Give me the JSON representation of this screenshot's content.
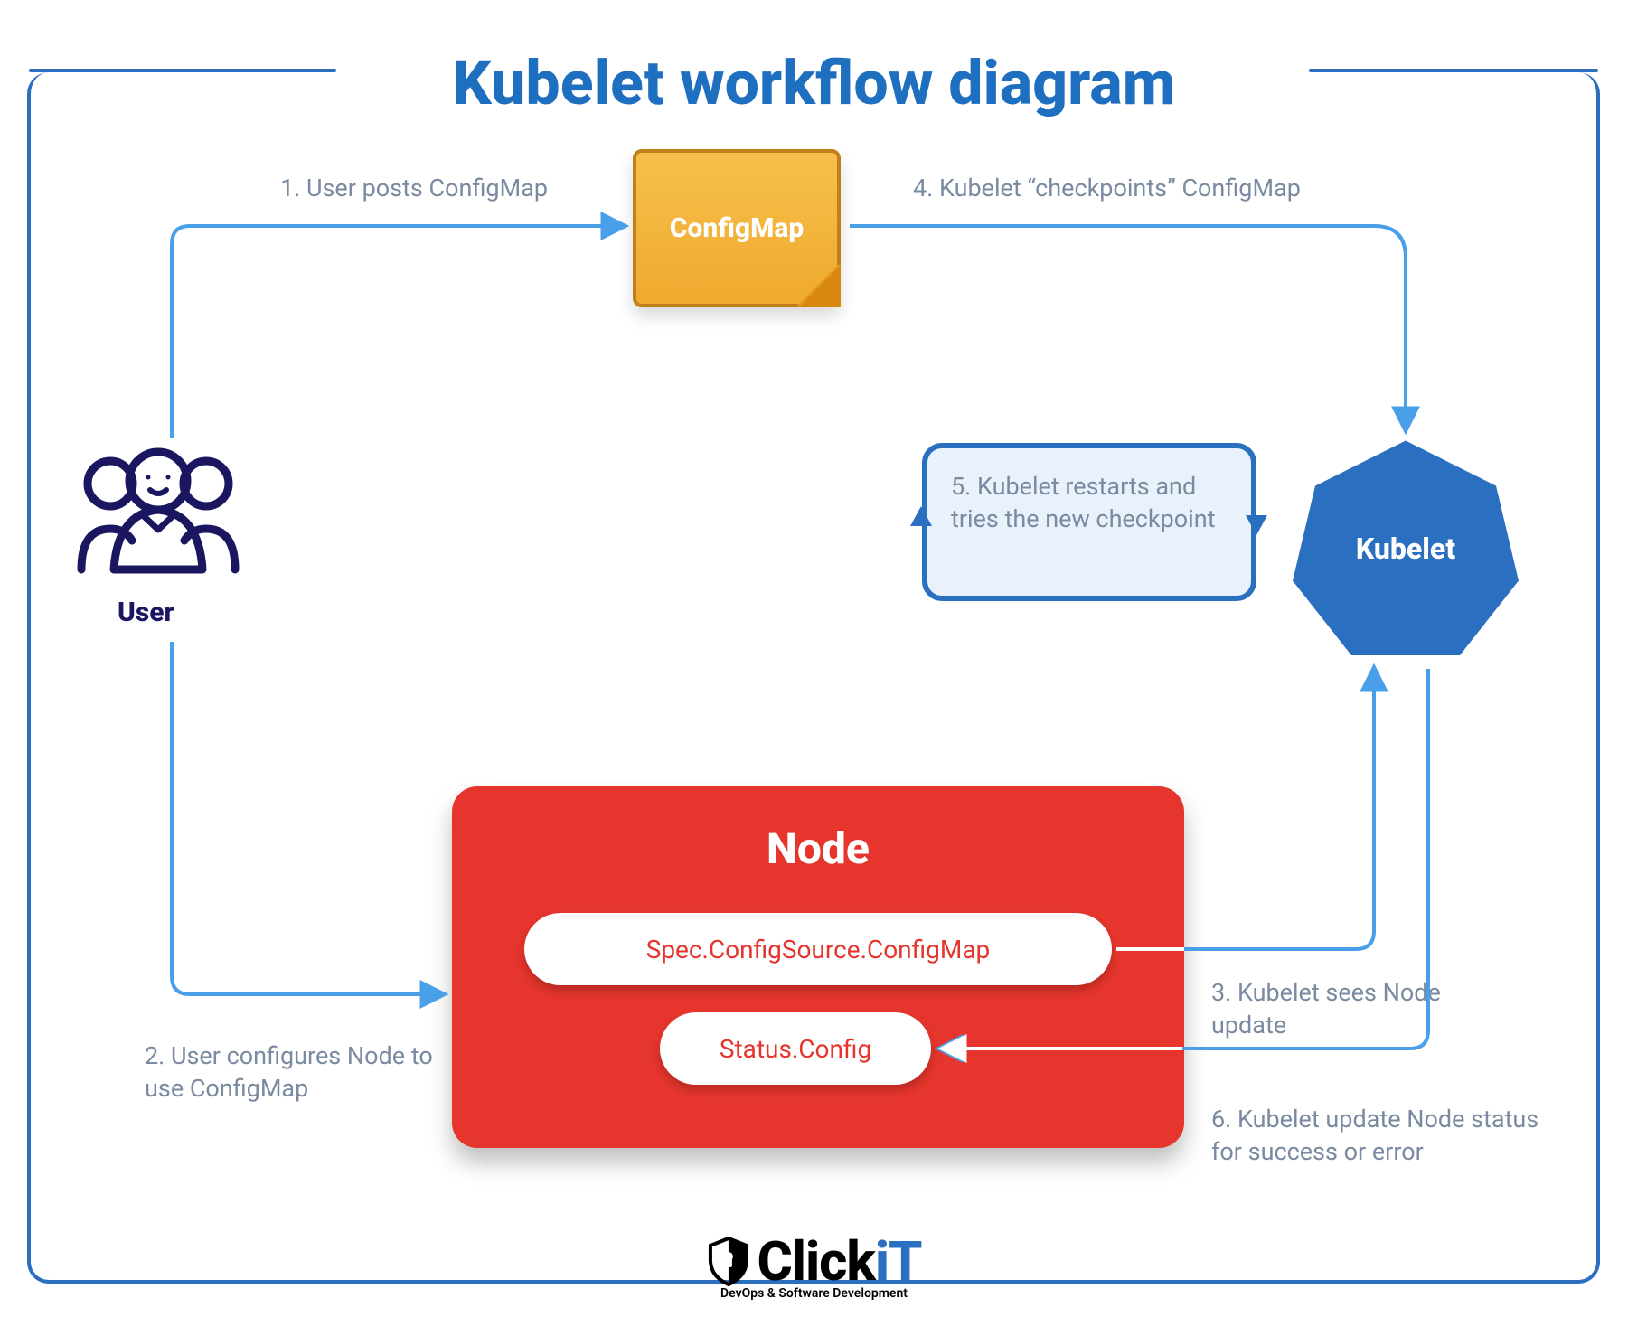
{
  "title": "Kubelet workflow diagram",
  "entities": {
    "user": "User",
    "configmap": "ConfigMap",
    "kubelet": "Kubelet",
    "node": "Node",
    "node_fields": {
      "spec": "Spec.ConfigSource.ConfigMap",
      "status": "Status.Config"
    }
  },
  "steps": {
    "s1": "1. User posts ConfigMap",
    "s2": "2. User configures Node to use ConfigMap",
    "s3": "3. Kubelet sees Node update",
    "s4": "4. Kubelet “checkpoints” ConfigMap",
    "s5": "5. Kubelet restarts and tries the new checkpoint",
    "s6": "6. Kubelet update Node status for success or error"
  },
  "logo": {
    "brand_prefix": "Click",
    "brand_suffix": "iT",
    "tagline": "DevOps & Software Development"
  },
  "colors": {
    "blue": "#2b6fc0",
    "lightblue": "#4aa0e8",
    "red": "#e5352c",
    "yellow": "#f0a92f",
    "navy": "#1a1760",
    "grey": "#7a8aa0"
  }
}
